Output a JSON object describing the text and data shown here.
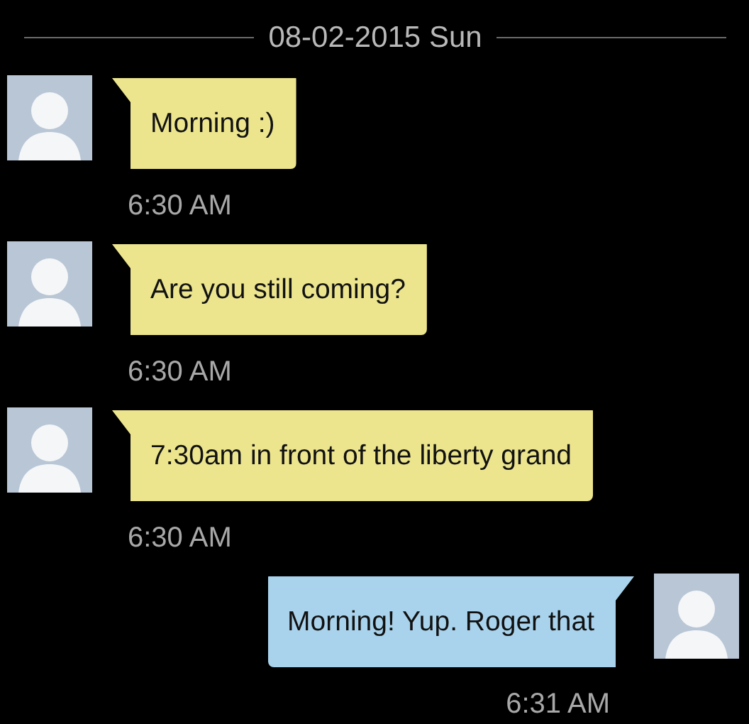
{
  "date_header": "08-02-2015 Sun",
  "messages": [
    {
      "kind": "incoming",
      "text": "Morning :)",
      "time": "6:30 AM"
    },
    {
      "kind": "incoming",
      "text": "Are you still coming?",
      "time": "6:30 AM"
    },
    {
      "kind": "incoming",
      "text": "7:30am in front of the liberty grand",
      "time": "6:30 AM"
    },
    {
      "kind": "outgoing",
      "text": "Morning! Yup. Roger that",
      "time": "6:31 AM"
    }
  ]
}
